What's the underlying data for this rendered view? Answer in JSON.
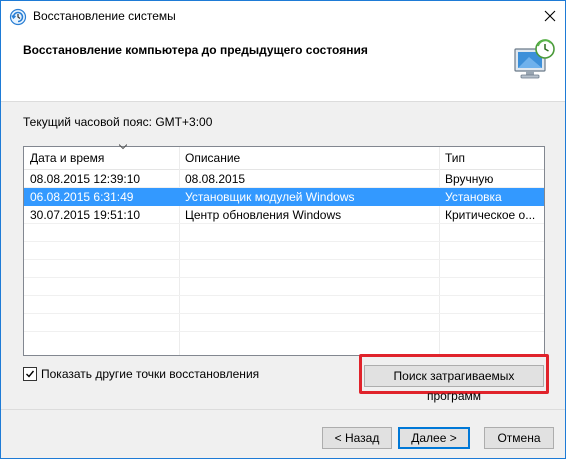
{
  "window": {
    "title": "Восстановление системы",
    "header_title": "Восстановление компьютера до предыдущего состояния"
  },
  "timezone_text": "Текущий часовой пояс: GMT+3:00",
  "table": {
    "columns": [
      "Дата и время",
      "Описание",
      "Тип"
    ],
    "rows": [
      {
        "date": "08.08.2015 12:39:10",
        "description": "08.08.2015",
        "type": "Вручную",
        "selected": false
      },
      {
        "date": "06.08.2015 6:31:49",
        "description": "Установщик модулей Windows",
        "type": "Установка",
        "selected": true
      },
      {
        "date": "30.07.2015 19:51:10",
        "description": "Центр обновления Windows",
        "type": "Критическое о...",
        "selected": false
      }
    ]
  },
  "show_more_label": "Показать другие точки восстановления",
  "show_more_checked": true,
  "scan_button_label": "Поиск затрагиваемых программ",
  "buttons": {
    "back": "< Назад",
    "next": "Далее >",
    "cancel": "Отмена"
  },
  "colors": {
    "selection": "#3399ff",
    "highlight": "#e0232b",
    "accent": "#0078d7"
  }
}
